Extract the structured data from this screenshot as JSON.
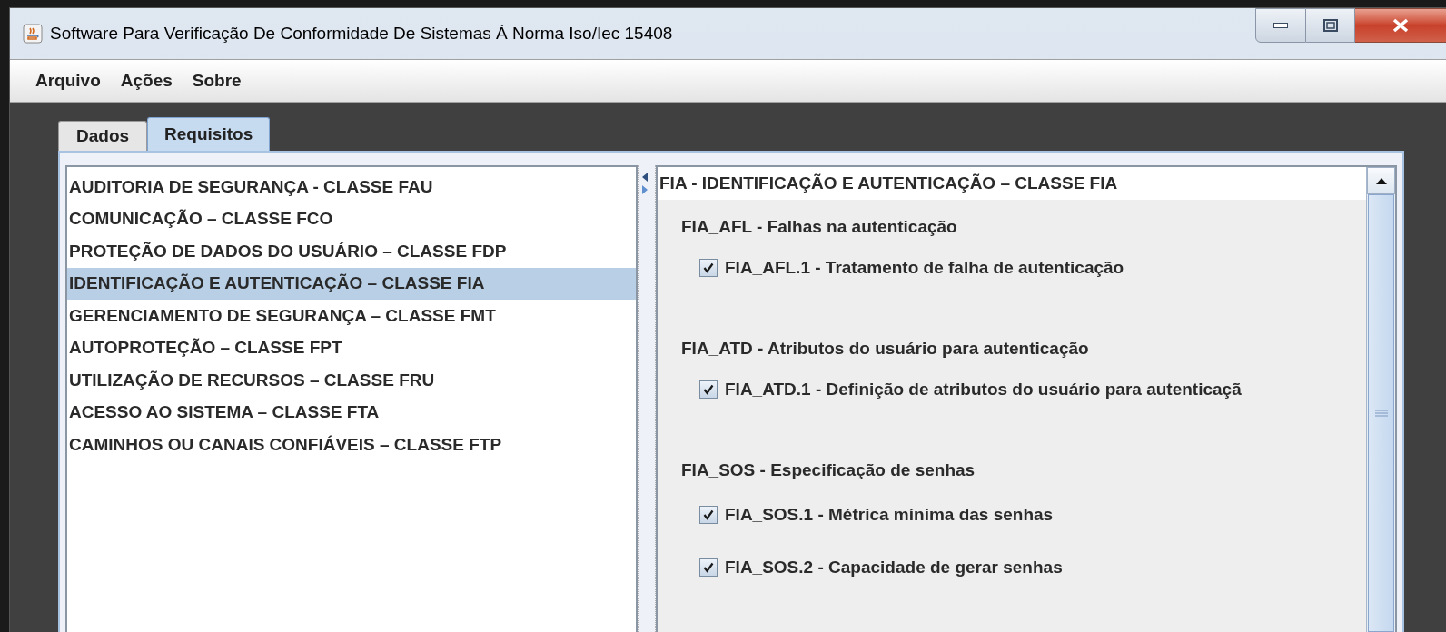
{
  "window": {
    "title": "Software Para Verificação De Conformidade De Sistemas À Norma Iso/Iec 15408"
  },
  "menu": [
    "Arquivo",
    "Ações",
    "Sobre"
  ],
  "tabs": [
    {
      "label": "Dados",
      "selected": false
    },
    {
      "label": "Requisitos",
      "selected": true
    }
  ],
  "classes": [
    {
      "label": "AUDITORIA DE SEGURANÇA - CLASSE FAU",
      "selected": false
    },
    {
      "label": "COMUNICAÇÃO – CLASSE FCO",
      "selected": false
    },
    {
      "label": "PROTEÇÃO DE DADOS DO USUÁRIO – CLASSE FDP",
      "selected": false
    },
    {
      "label": "IDENTIFICAÇÃO E AUTENTICAÇÃO – CLASSE FIA",
      "selected": true
    },
    {
      "label": "GERENCIAMENTO DE SEGURANÇA – CLASSE FMT",
      "selected": false
    },
    {
      "label": "AUTOPROTEÇÃO – CLASSE FPT",
      "selected": false
    },
    {
      "label": "UTILIZAÇÃO DE RECURSOS – CLASSE FRU",
      "selected": false
    },
    {
      "label": "ACESSO AO SISTEMA – CLASSE FTA",
      "selected": false
    },
    {
      "label": "CAMINHOS OU CANAIS CONFIÁVEIS – CLASSE FTP",
      "selected": false
    }
  ],
  "detail": {
    "title": "FIA - IDENTIFICAÇÃO E AUTENTICAÇÃO – CLASSE FIA",
    "families": [
      {
        "label": "FIA_AFL - Falhas na autenticação",
        "requirements": [
          {
            "label": "**FIA_AFL.1** - Tratamento de falha de autenticação",
            "checked": true
          }
        ]
      },
      {
        "label": "FIA_ATD - Atributos do usuário para autenticação",
        "requirements": [
          {
            "label": "**FIA_ATD.1** - Definição de atributos do usuário para autenticaçã",
            "checked": true
          }
        ]
      },
      {
        "label": "FIA_SOS - Especificação de senhas",
        "requirements": [
          {
            "label": "**FIA_SOS.1** - Métrica mínima das senhas",
            "checked": true
          },
          {
            "label": "**FIA_SOS.2** - Capacidade de gerar senhas",
            "checked": true
          }
        ]
      }
    ]
  }
}
